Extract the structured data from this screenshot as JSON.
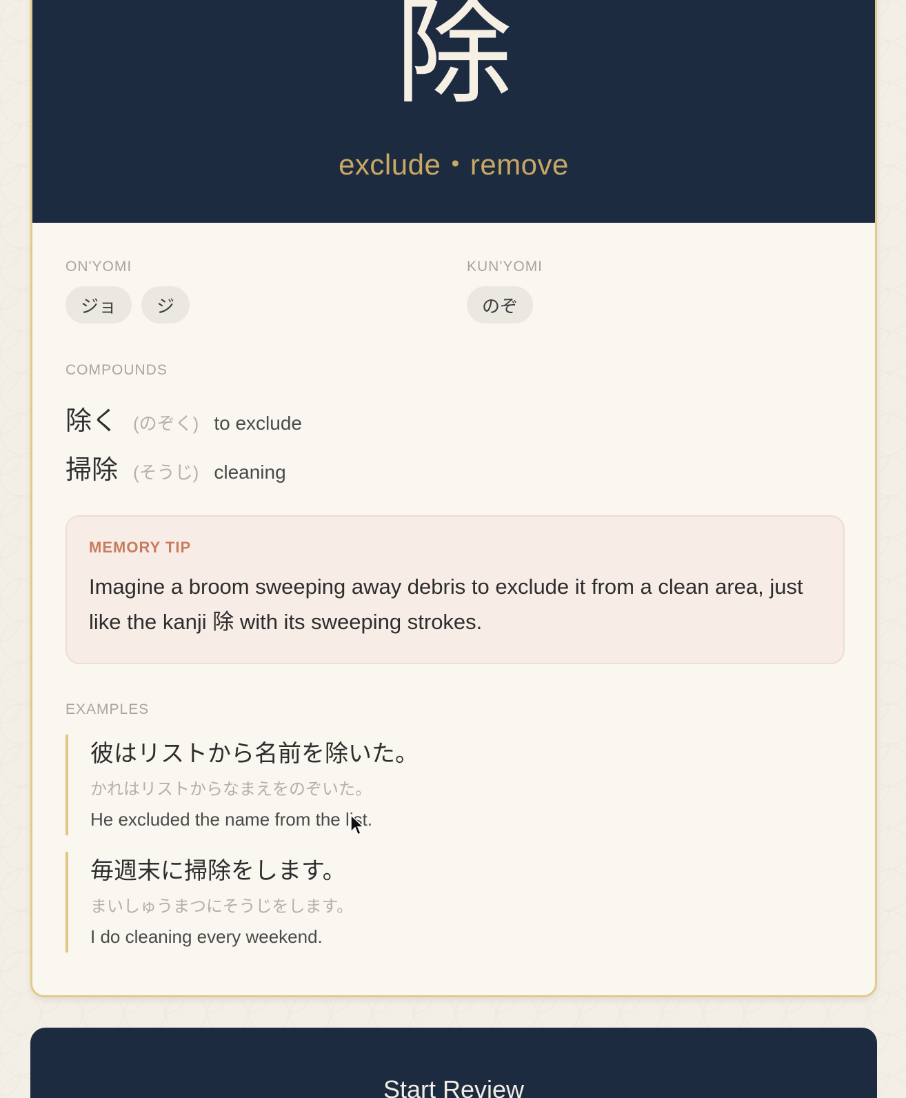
{
  "kanji": {
    "character": "除",
    "meaning": "exclude・remove"
  },
  "onyomi": {
    "label": "ON'YOMI",
    "readings": [
      "ジョ",
      "ジ"
    ]
  },
  "kunyomi": {
    "label": "KUN'YOMI",
    "readings": [
      "のぞ"
    ]
  },
  "compounds": {
    "label": "COMPOUNDS",
    "items": [
      {
        "word": "除く",
        "reading": "(のぞく)",
        "meaning": "to exclude"
      },
      {
        "word": "掃除",
        "reading": "(そうじ)",
        "meaning": "cleaning"
      }
    ]
  },
  "memory_tip": {
    "label": "MEMORY TIP",
    "text": "Imagine a broom sweeping away debris to exclude it from a clean area, just like the kanji 除 with its sweeping strokes."
  },
  "examples": {
    "label": "EXAMPLES",
    "items": [
      {
        "japanese": "彼はリストから名前を除いた。",
        "kana": "かれはリストからなまえをのぞいた。",
        "english": "He excluded the name from the list."
      },
      {
        "japanese": "毎週末に掃除をします。",
        "kana": "まいしゅうまつにそうじをします。",
        "english": "I do cleaning every weekend."
      }
    ]
  },
  "actions": {
    "start_review": "Start Review"
  }
}
